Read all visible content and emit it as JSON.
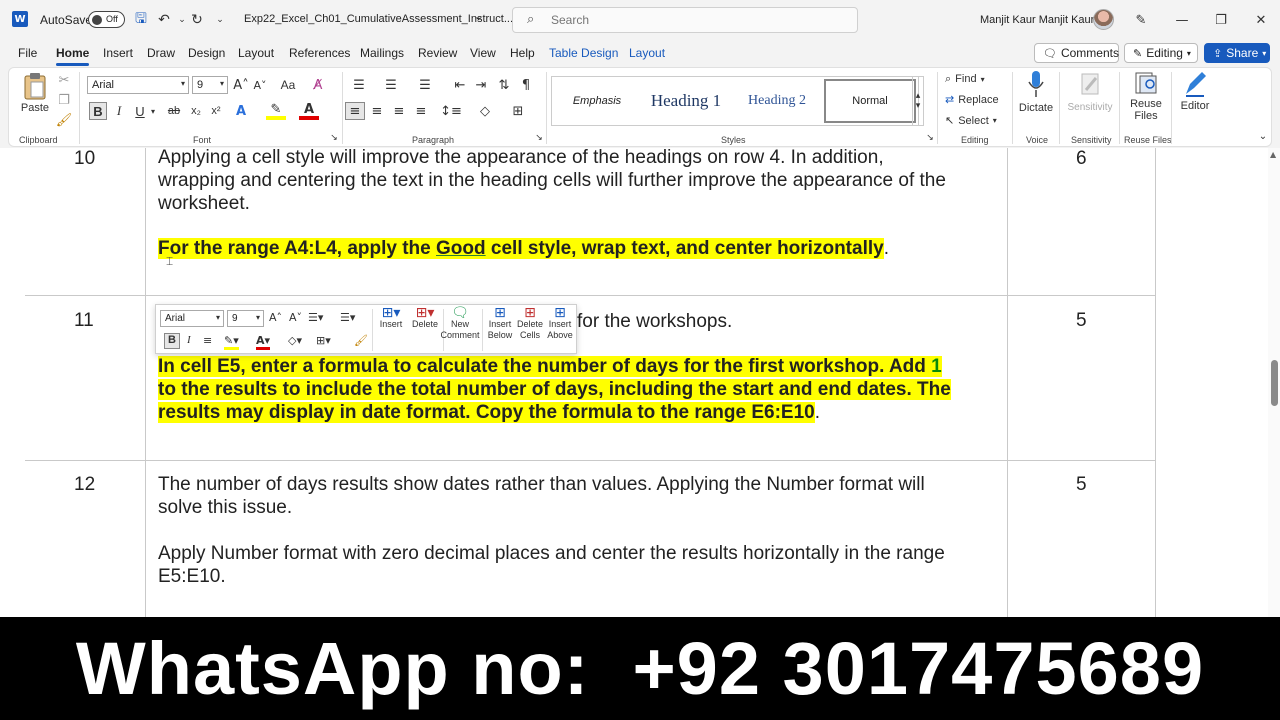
{
  "titlebar": {
    "autosave_label": "AutoSave",
    "autosave_state": "Off",
    "document_title": "Exp22_Excel_Ch01_CumulativeAssessment_Instruct...",
    "search_placeholder": "Search",
    "user_name": "Manjit Kaur Manjit Kaur",
    "app_icon_letter": "W"
  },
  "menu": {
    "tabs": [
      "File",
      "Home",
      "Insert",
      "Draw",
      "Design",
      "Layout",
      "References",
      "Mailings",
      "Review",
      "View",
      "Help",
      "Table Design",
      "Layout"
    ],
    "active_tab": "Home",
    "comments_label": "Comments",
    "editing_label": "Editing",
    "share_label": "Share"
  },
  "ribbon": {
    "clipboard": {
      "paste_label": "Paste",
      "group_label": "Clipboard"
    },
    "font": {
      "font_name": "Arial",
      "font_size": "9",
      "group_label": "Font",
      "bold": "B",
      "italic": "I",
      "underline": "U",
      "strike": "ab",
      "subscript": "x₂",
      "superscript": "x²",
      "case": "Aa"
    },
    "paragraph": {
      "group_label": "Paragraph"
    },
    "styles": {
      "items": [
        "Emphasis",
        "Heading 1",
        "Heading 2",
        "Normal"
      ],
      "group_label": "Styles"
    },
    "editing": {
      "find": "Find",
      "replace": "Replace",
      "select": "Select",
      "group_label": "Editing"
    },
    "voice": {
      "dictate": "Dictate",
      "group_label": "Voice"
    },
    "sensitivity": {
      "label": "Sensitivity",
      "group_label": "Sensitivity"
    },
    "reuse": {
      "label_line1": "Reuse",
      "label_line2": "Files",
      "group_label": "Reuse Files"
    },
    "editor": {
      "label": "Editor"
    }
  },
  "document": {
    "rows": [
      {
        "number": "10",
        "points": "6",
        "intro_lines": [
          "Applying a cell style will improve the appearance of the headings on row 4. In addition,",
          "wrapping and centering the text in the heading cells will further improve the appearance of the",
          "worksheet."
        ],
        "instruction_before": "For the range A4:L4, apply the ",
        "instruction_keyword": "Good",
        "instruction_after": " cell style, wrap text, and center horizontally",
        "instruction_end": "."
      },
      {
        "number": "11",
        "points": "5",
        "intro_visible": "for the workshops.",
        "instruction_lines": [
          "In cell E5, enter a formula to calculate the number of days for the first workshop. Add ",
          "to the results to include the total number of days, including the start and end dates. The",
          "results may display in date format. Copy the formula to the range E6:E10"
        ],
        "instruction_highlight_num": "1",
        "instruction_end": "."
      },
      {
        "number": "12",
        "points": "5",
        "intro_lines": [
          "The number of days results show dates rather than values. Applying the Number format will",
          "solve this issue."
        ],
        "instruction_lines": [
          "Apply Number format with zero decimal places and center the results horizontally in the range",
          "E5:E10."
        ]
      }
    ]
  },
  "mini_toolbar": {
    "font_name": "Arial",
    "font_size": "9",
    "insert": "Insert",
    "delete": "Delete",
    "new_comment_1": "New",
    "new_comment_2": "Comment",
    "insert_below_1": "Insert",
    "insert_below_2": "Below",
    "delete_cells_1": "Delete",
    "delete_cells_2": "Cells",
    "insert_above_1": "Insert",
    "insert_above_2": "Above",
    "bold": "B",
    "italic": "I"
  },
  "banner": {
    "text": "WhatsApp no:  +92 3017475689"
  },
  "colors": {
    "accent": "#185abd",
    "highlight": "#ffff00",
    "banner_bg": "#000000"
  }
}
